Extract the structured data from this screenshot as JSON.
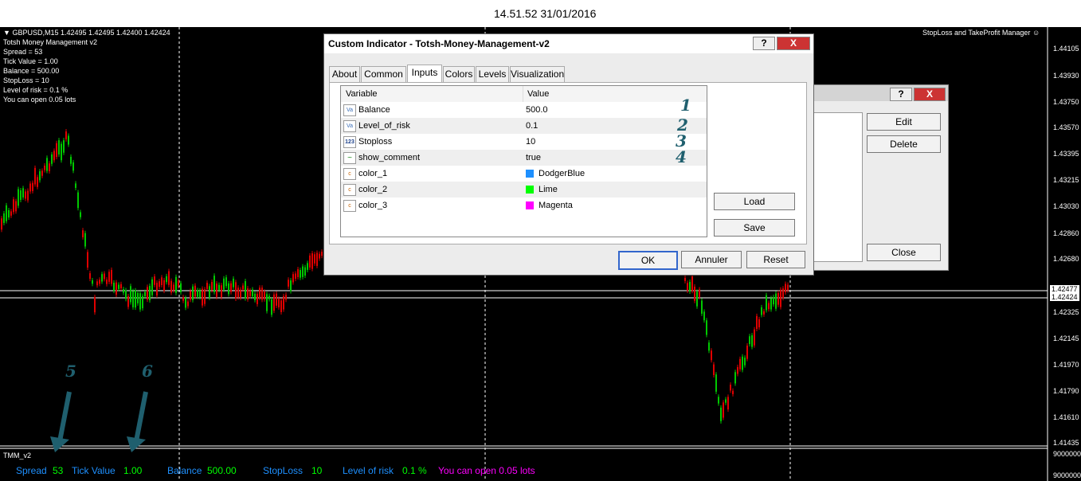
{
  "header": {
    "timestamp": "14.51.52 31/01/2016"
  },
  "chart_overlay": {
    "symbol_line": "GBPUSD,M15  1.42495 1.42495 1.42400 1.42424",
    "top_right_label": "StopLoss and TakeProfit Manager",
    "info_lines": [
      "Totsh Money Management v2",
      "Spread = 53",
      "Tick Value = 1.00",
      "Balance = 500.00",
      "StopLoss = 10",
      "Level of risk = 0.1 %",
      "You can open 0.05 lots"
    ],
    "price_labels": [
      "1.44105",
      "1.43930",
      "1.43750",
      "1.43570",
      "1.43395",
      "1.43215",
      "1.43030",
      "1.42860",
      "1.42680",
      "1.42477",
      "1.42424",
      "1.42325",
      "1.42145",
      "1.41970",
      "1.41790",
      "1.41610",
      "1.41435"
    ],
    "indicator_scale_labels": [
      "9000000",
      "9000000"
    ]
  },
  "indicator_panel": {
    "name": "TMM_v2",
    "items": [
      {
        "label": "Spread",
        "value": "53"
      },
      {
        "label": "Tick Value",
        "value": "1.00"
      },
      {
        "label": "Balance",
        "value": "500.00"
      },
      {
        "label": "StopLoss",
        "value": "10"
      },
      {
        "label": "Level of risk",
        "value": "0.1 %"
      }
    ],
    "lots_text": "You can open 0.05 lots"
  },
  "annotations": [
    "1",
    "2",
    "3",
    "4",
    "5",
    "6"
  ],
  "dialog": {
    "title": "Custom Indicator - Totsh-Money-Management-v2",
    "help_btn": "?",
    "close_btn": "X",
    "tabs": [
      "About",
      "Common",
      "Inputs",
      "Colors",
      "Levels",
      "Visualization"
    ],
    "active_tab": "Inputs",
    "table_header": {
      "variable": "Variable",
      "value": "Value"
    },
    "rows": [
      {
        "icon": "Va",
        "name": "Balance",
        "value": "500.0"
      },
      {
        "icon": "Va",
        "name": "Level_of_risk",
        "value": "0.1"
      },
      {
        "icon": "123",
        "name": "Stoploss",
        "value": "10"
      },
      {
        "icon": "~",
        "name": "show_comment",
        "value": "true"
      },
      {
        "icon": "c",
        "name": "color_1",
        "value": "DodgerBlue",
        "swatch": "#1e90ff"
      },
      {
        "icon": "c",
        "name": "color_2",
        "value": "Lime",
        "swatch": "#00ff00"
      },
      {
        "icon": "c",
        "name": "color_3",
        "value": "Magenta",
        "swatch": "#ff00ff"
      }
    ],
    "load_btn": "Load",
    "save_btn": "Save",
    "ok_btn": "OK",
    "cancel_btn": "Annuler",
    "reset_btn": "Reset"
  },
  "background_dialog": {
    "help_btn": "?",
    "close_btn": "X",
    "edit_btn": "Edit",
    "delete_btn": "Delete",
    "close_action_btn": "Close"
  },
  "colors": {
    "spread_label": "#1e90ff",
    "value_green": "#00ff00",
    "lots_magenta": "#ff00ff",
    "bull_candle": "#00c800",
    "bear_candle": "#e00000",
    "annotation": "#1f5f6e",
    "title_bar": "#ffffff"
  }
}
